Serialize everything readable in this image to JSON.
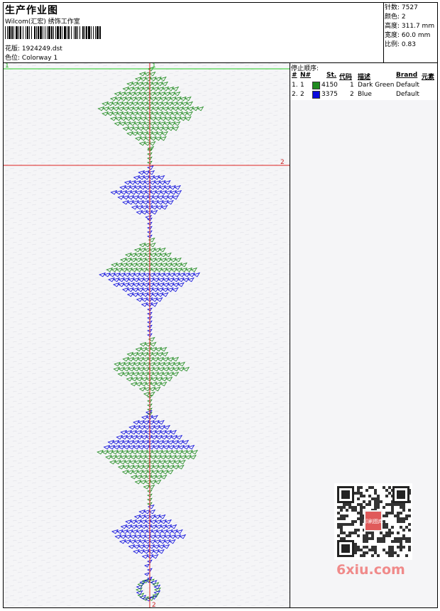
{
  "header": {
    "title": "生产作业图",
    "subtitle": "Wilcom(汇宏) 绣饰工作室",
    "design_label": "花版:",
    "design_value": "1924249.dst",
    "colorway_label": "色位:",
    "colorway_value": "Colorway 1"
  },
  "stats": {
    "stitches_label": "针数:",
    "stitches_value": "7527",
    "colors_label": "颜色:",
    "colors_value": "2",
    "height_label": "高度:",
    "height_value": "311.7 mm",
    "width_label": "宽度:",
    "width_value": "60.0 mm",
    "scale_label": "比例:",
    "scale_value": "0.83"
  },
  "stop_sequence": {
    "title": "停止顺序:",
    "headers": {
      "num": "#",
      "needle": "N#",
      "st": "St.",
      "code": "代码",
      "desc": "描述",
      "brand": "Brand",
      "element": "元素"
    },
    "rows": [
      {
        "num": "1.",
        "needle": "1",
        "color": "#1e8a1e",
        "st": "4150",
        "code": "1",
        "desc": "Dark Green",
        "brand": "Default"
      },
      {
        "num": "2.",
        "needle": "2",
        "color": "#0a0adc",
        "st": "3375",
        "code": "2",
        "desc": "Blue",
        "brand": "Default"
      }
    ]
  },
  "canvas": {
    "marker_1_left": "1",
    "marker_1_center": "1",
    "marker_2_right": "2",
    "marker_2_bottom": "2",
    "green": "#1e8a1e",
    "blue": "#0a0adc"
  },
  "watermark": {
    "text": "6xiu.com",
    "qr_badge": "印刷图库"
  }
}
